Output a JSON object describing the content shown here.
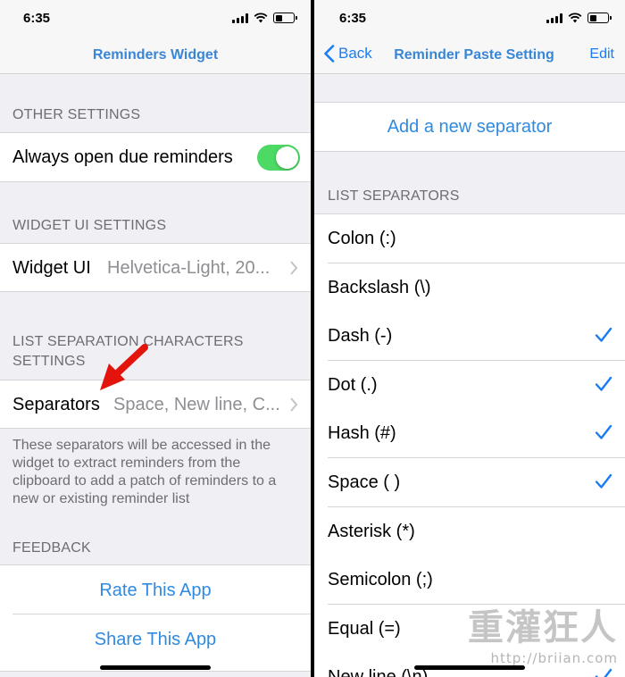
{
  "left": {
    "status": {
      "time": "6:35"
    },
    "nav_title": "Reminders Widget",
    "other_settings": {
      "header": "OTHER SETTINGS",
      "always_open_label": "Always open due reminders",
      "always_open_on": true
    },
    "widget_ui": {
      "header": "WIDGET UI SETTINGS",
      "label": "Widget UI",
      "value": "Helvetica-Light, 20..."
    },
    "list_separation": {
      "header_line1": "LIST SEPARATION CHARACTERS",
      "header_line2": "SETTINGS",
      "label": "Separators",
      "value": "Space, New line, C...",
      "footer": "These separators will be accessed in the widget to extract reminders from the clipboard to add a patch of reminders to a new or existing reminder list"
    },
    "feedback": {
      "header": "FEEDBACK",
      "rate": "Rate This App",
      "share": "Share This App"
    }
  },
  "right": {
    "status": {
      "time": "6:35"
    },
    "nav_back": "Back",
    "nav_title": "Reminder Paste Setting",
    "nav_edit": "Edit",
    "add_separator": "Add a new separator",
    "list_header": "LIST SEPARATORS",
    "separators": [
      {
        "label": "Colon (:)",
        "checked": false
      },
      {
        "label": "Backslash (\\)",
        "checked": false
      },
      {
        "label": "Dash (-)",
        "checked": true
      },
      {
        "label": "Dot (.)",
        "checked": true
      },
      {
        "label": "Hash (#)",
        "checked": true
      },
      {
        "label": "Space ( )",
        "checked": true
      },
      {
        "label": "Asterisk (*)",
        "checked": false
      },
      {
        "label": "Semicolon (;)",
        "checked": false
      },
      {
        "label": "Equal (=)",
        "checked": false
      },
      {
        "label": "New line (\\n)",
        "checked": true
      }
    ]
  },
  "watermark": {
    "title": "重灌狂人",
    "url": "http://briian.com"
  },
  "colors": {
    "accent": "#1a7cf5",
    "toggle_on": "#4cd964",
    "annotation_arrow": "#e3140c"
  }
}
